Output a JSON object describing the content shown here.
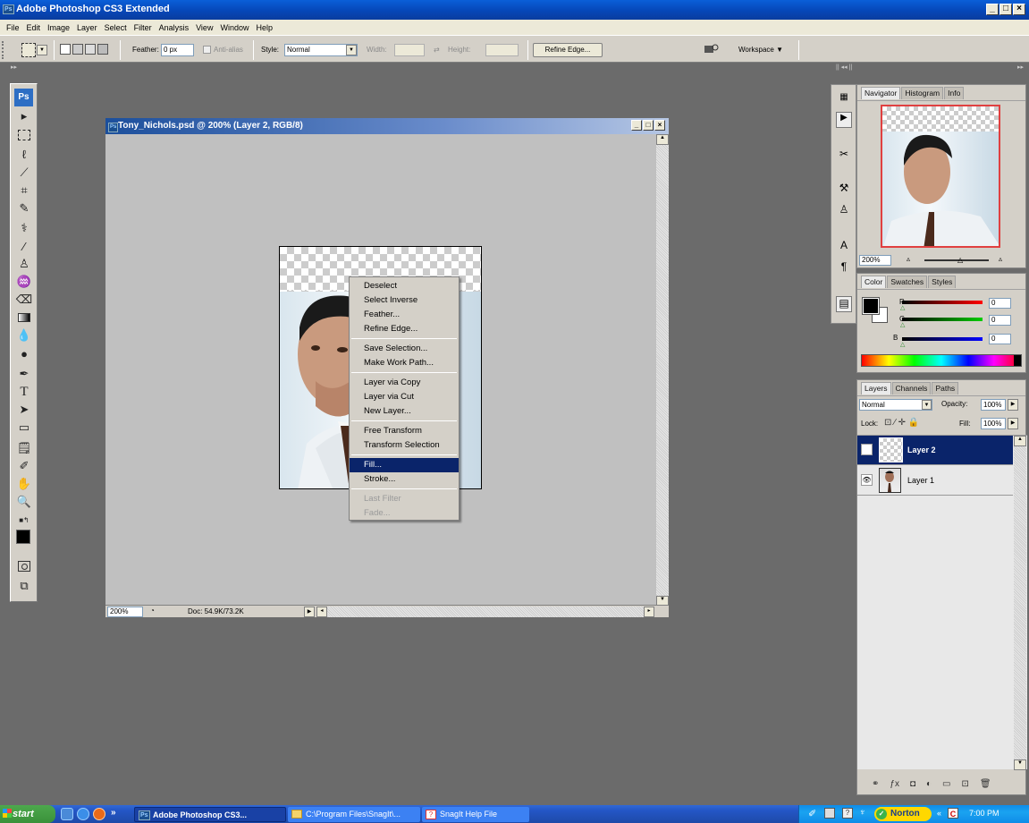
{
  "app": {
    "title": "Adobe Photoshop CS3 Extended",
    "logo": "Ps"
  },
  "menu": [
    "File",
    "Edit",
    "Image",
    "Layer",
    "Select",
    "Filter",
    "Analysis",
    "View",
    "Window",
    "Help"
  ],
  "options": {
    "feather_label": "Feather:",
    "feather_value": "0 px",
    "antialias_label": "Anti-alias",
    "style_label": "Style:",
    "style_value": "Normal",
    "width_label": "Width:",
    "height_label": "Height:",
    "refine_edge": "Refine Edge...",
    "workspace": "Workspace ▼"
  },
  "toolbox": {
    "logo": "Ps"
  },
  "document": {
    "title": "Tony_Nichols.psd @ 200% (Layer 2, RGB/8)",
    "zoom": "200%",
    "doc_size": "Doc: 54.9K/73.2K"
  },
  "context_menu": [
    {
      "label": "Deselect"
    },
    {
      "label": "Select Inverse"
    },
    {
      "label": "Feather..."
    },
    {
      "label": "Refine Edge..."
    },
    {
      "sep": true
    },
    {
      "label": "Save Selection..."
    },
    {
      "label": "Make Work Path..."
    },
    {
      "sep": true
    },
    {
      "label": "Layer via Copy"
    },
    {
      "label": "Layer via Cut"
    },
    {
      "label": "New Layer..."
    },
    {
      "sep": true
    },
    {
      "label": "Free Transform"
    },
    {
      "label": "Transform Selection"
    },
    {
      "sep": true
    },
    {
      "label": "Fill...",
      "highlighted": true
    },
    {
      "label": "Stroke..."
    },
    {
      "sep": true
    },
    {
      "label": "Last Filter",
      "disabled": true
    },
    {
      "label": "Fade...",
      "disabled": true
    }
  ],
  "navigator": {
    "tabs": [
      "Navigator",
      "Histogram",
      "Info"
    ],
    "zoom": "200%"
  },
  "color": {
    "tabs": [
      "Color",
      "Swatches",
      "Styles"
    ],
    "r": "0",
    "g": "0",
    "b": "0",
    "r_label": "R",
    "g_label": "G",
    "b_label": "B"
  },
  "layers": {
    "tabs": [
      "Layers",
      "Channels",
      "Paths"
    ],
    "blend": "Normal",
    "opacity_label": "Opacity:",
    "opacity": "100%",
    "lock_label": "Lock:",
    "fill_label": "Fill:",
    "fill": "100%",
    "items": [
      {
        "name": "Layer 2",
        "selected": true
      },
      {
        "name": "Layer 1",
        "selected": false
      }
    ]
  },
  "taskbar": {
    "start": "start",
    "tasks": [
      "Adobe Photoshop CS3...",
      "C:\\Program Files\\SnagIt\\...",
      "SnagIt Help File"
    ],
    "norton": "Norton",
    "time": "7:00 PM",
    "chevron": "»",
    "tray_chevron": "«"
  },
  "colors": {
    "accent": "#0a246a",
    "xp_blue": "#2456c6"
  }
}
